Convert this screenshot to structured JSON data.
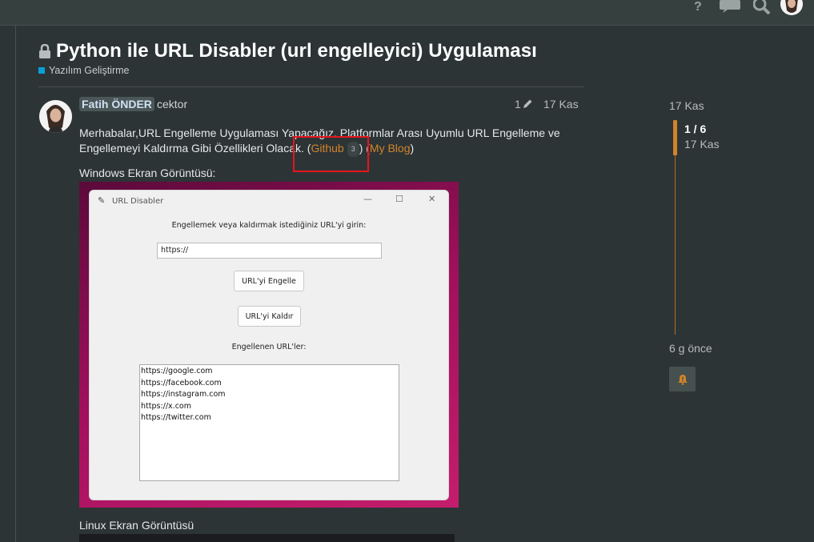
{
  "topic": {
    "title": "Python ile URL Disabler (url engelleyici) Uygulaması",
    "category": "Yazılım Geliştirme",
    "category_color": "#0aa0d8"
  },
  "post": {
    "author": "Fatih ÖNDER",
    "username": "cektor",
    "edit_count": "1",
    "date": "17 Kas",
    "text_part1": "Merhabalar,URL Engelleme Uygulaması Yapacağız. Platformlar Arası Uyumlu URL Engelleme ve Engellemeyi Kaldırma Gibi Özellikleri Olacak. (",
    "github_link": "Github",
    "github_clicks": "3",
    "text_mid": ") (",
    "blog_link": "My Blog",
    "text_end": ")",
    "windows_label": "Windows Ekran Görüntüsü:",
    "linux_label": "Linux Ekran Görüntüsü"
  },
  "app_window": {
    "title": "URL Disabler",
    "prompt": "Engellemek veya kaldırmak istediğiniz URL'yi girin:",
    "input_value": "https://",
    "block_button": "URL'yi Engelle",
    "unblock_button": "URL'yi Kaldır",
    "list_label": "Engellenen URL'ler:",
    "blocked_urls": [
      "https://google.com",
      "https://facebook.com",
      "https://instagram.com",
      "https://x.com",
      "https://twitter.com"
    ]
  },
  "timeline": {
    "top_date": "17 Kas",
    "position": "1 / 6",
    "position_date": "17 Kas",
    "bottom_label": "6 g önce"
  },
  "colors": {
    "accent": "#d2842a",
    "highlight_box": "#e8141b"
  }
}
